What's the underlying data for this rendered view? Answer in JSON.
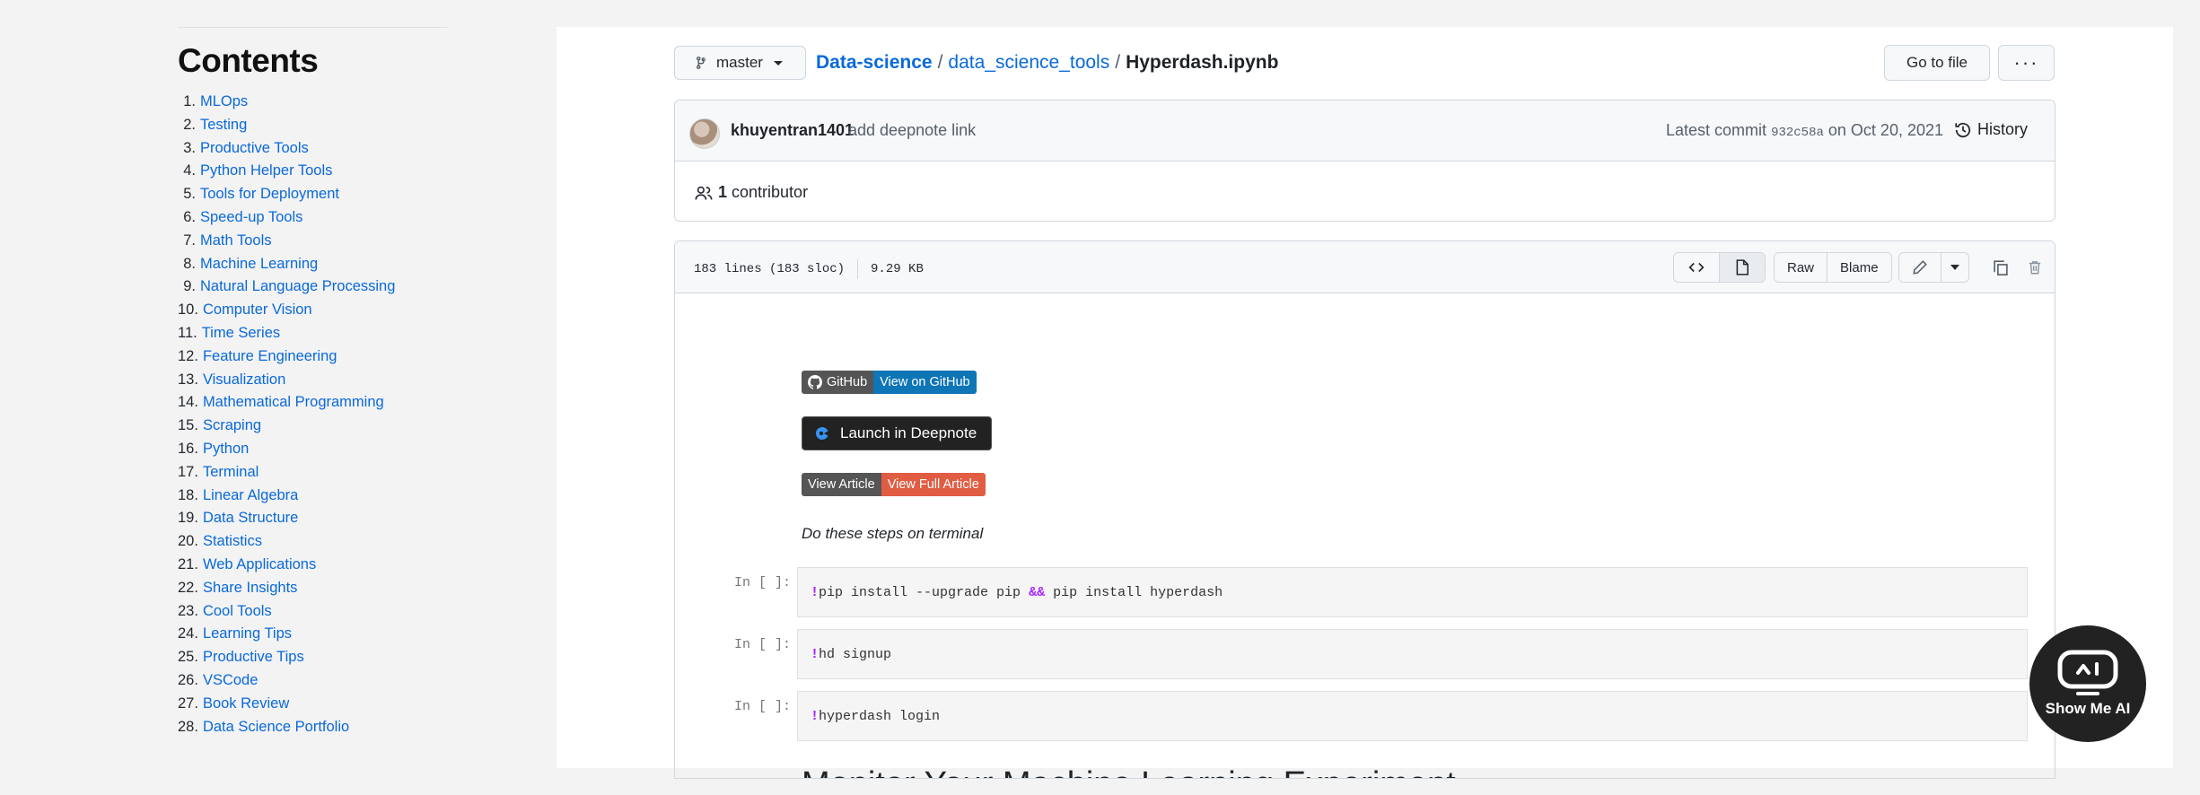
{
  "toc": {
    "title": "Contents",
    "items": [
      {
        "num": "1.",
        "label": "MLOps"
      },
      {
        "num": "2.",
        "label": "Testing"
      },
      {
        "num": "3.",
        "label": "Productive Tools"
      },
      {
        "num": "4.",
        "label": "Python Helper Tools"
      },
      {
        "num": "5.",
        "label": "Tools for Deployment"
      },
      {
        "num": "6.",
        "label": "Speed-up Tools"
      },
      {
        "num": "7.",
        "label": "Math Tools"
      },
      {
        "num": "8.",
        "label": "Machine Learning"
      },
      {
        "num": "9.",
        "label": "Natural Language Processing"
      },
      {
        "num": "10.",
        "label": "Computer Vision"
      },
      {
        "num": "11.",
        "label": "Time Series"
      },
      {
        "num": "12.",
        "label": "Feature Engineering"
      },
      {
        "num": "13.",
        "label": "Visualization"
      },
      {
        "num": "14.",
        "label": "Mathematical Programming"
      },
      {
        "num": "15.",
        "label": "Scraping"
      },
      {
        "num": "16.",
        "label": "Python"
      },
      {
        "num": "17.",
        "label": "Terminal"
      },
      {
        "num": "18.",
        "label": "Linear Algebra"
      },
      {
        "num": "19.",
        "label": "Data Structure"
      },
      {
        "num": "20.",
        "label": "Statistics"
      },
      {
        "num": "21.",
        "label": "Web Applications"
      },
      {
        "num": "22.",
        "label": "Share Insights"
      },
      {
        "num": "23.",
        "label": "Cool Tools"
      },
      {
        "num": "24.",
        "label": "Learning Tips"
      },
      {
        "num": "25.",
        "label": "Productive Tips"
      },
      {
        "num": "26.",
        "label": "VSCode"
      },
      {
        "num": "27.",
        "label": "Book Review"
      },
      {
        "num": "28.",
        "label": "Data Science Portfolio"
      }
    ]
  },
  "header": {
    "branch": "master",
    "breadcrumb": {
      "repo": "Data-science",
      "sep1": "/",
      "folder": "data_science_tools",
      "sep2": "/",
      "file": "Hyperdash.ipynb"
    },
    "goto_file": "Go to file",
    "more": "···"
  },
  "commit": {
    "author": "khuyentran1401",
    "message": "add deepnote link",
    "latest_prefix": "Latest commit",
    "sha": "932c58a",
    "date_text": "on Oct 20, 2021",
    "history": "History",
    "contributors_count": "1",
    "contributors_label": "contributor"
  },
  "file": {
    "lines": "183 lines (183 sloc)",
    "size": "9.29 KB",
    "raw": "Raw",
    "blame": "Blame"
  },
  "notebook": {
    "badge_github_left": "GitHub",
    "badge_github_right": "View on GitHub",
    "deepnote": "Launch in Deepnote",
    "badge_article_left": "View Article",
    "badge_article_right": "View Full Article",
    "steps_text": "Do these steps on terminal",
    "cells": [
      {
        "prompt": "In [ ]:",
        "bang": "!",
        "code_a": "pip install --upgrade pip ",
        "amp": "&&",
        "code_b": " pip install hyperdash"
      },
      {
        "prompt": "In [ ]:",
        "bang": "!",
        "code": "hd signup"
      },
      {
        "prompt": "In [ ]:",
        "bang": "!",
        "code": "hyperdash login"
      }
    ],
    "heading": "Monitor Your Machine Learning Experiment"
  },
  "overlay": {
    "label": "Show Me AI"
  },
  "colors": {
    "link": "#0969da",
    "badge_blue": "#0e75b6",
    "badge_red": "#e05d44",
    "badge_gray": "#555555",
    "magic": "#aa22ff"
  }
}
